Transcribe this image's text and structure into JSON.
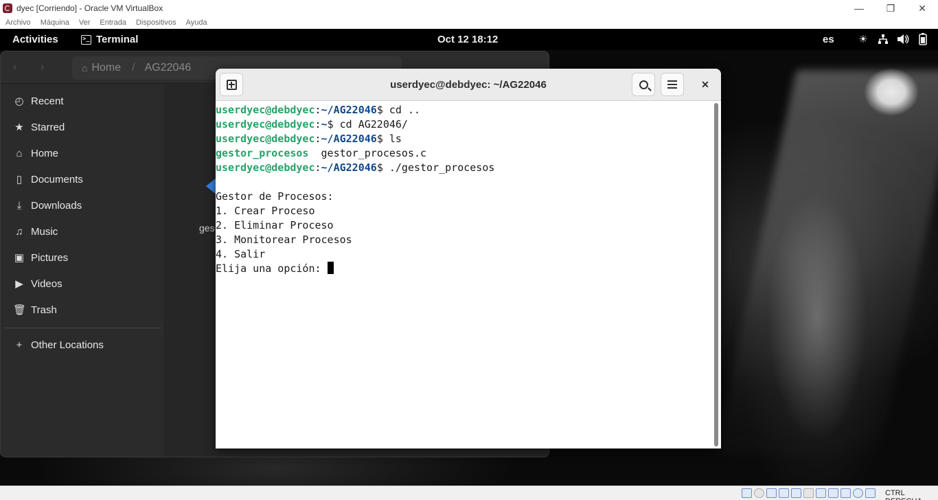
{
  "host_window": {
    "title": "dyec [Corriendo] - Oracle VM VirtualBox",
    "controls": {
      "minimize": "—",
      "restore": "❐",
      "close": "✕"
    },
    "menu": [
      "Archivo",
      "Máquina",
      "Ver",
      "Entrada",
      "Dispositivos",
      "Ayuda"
    ],
    "statusbar": {
      "host_key": "CTRL DERECHA"
    }
  },
  "topbar": {
    "activities": "Activities",
    "app_name": "Terminal",
    "clock": "Oct 12  18:12",
    "keyboard_layout": "es",
    "tray_icons": [
      "brightness-icon",
      "network-icon",
      "volume-icon",
      "battery-icon"
    ]
  },
  "files": {
    "pathbar": {
      "home": "Home",
      "current": "AG22046"
    },
    "sidebar": [
      {
        "label": "Recent",
        "icon": "clock-icon"
      },
      {
        "label": "Starred",
        "icon": "star-icon"
      },
      {
        "label": "Home",
        "icon": "home-icon"
      },
      {
        "label": "Documents",
        "icon": "document-icon"
      },
      {
        "label": "Downloads",
        "icon": "download-icon"
      },
      {
        "label": "Music",
        "icon": "music-icon"
      },
      {
        "label": "Pictures",
        "icon": "picture-icon"
      },
      {
        "label": "Videos",
        "icon": "video-icon"
      },
      {
        "label": "Trash",
        "icon": "trash-icon"
      }
    ],
    "other_locations": "Other Locations",
    "visible_item_fragment": "ges"
  },
  "terminal": {
    "title": "userdyec@debdyec: ~/AG22046",
    "prompt_user": "userdyec@debdyec",
    "lines": {
      "l1_path": "~/AG22046",
      "l1_cmd": "$ cd ..",
      "l2_path": "~",
      "l2_cmd": "$ cd AG22046/",
      "l3_path": "~/AG22046",
      "l3_cmd": "$ ls",
      "ls_exec": "gestor_procesos",
      "ls_file": "  gestor_procesos.c",
      "l5_path": "~/AG22046",
      "l5_cmd": "$ ./gestor_procesos",
      "menu_title": "Gestor de Procesos:",
      "opt1": "1. Crear Proceso",
      "opt2": "2. Eliminar Proceso",
      "opt3": "3. Monitorear Procesos",
      "opt4": "4. Salir",
      "prompt": "Elija una opción: "
    }
  },
  "colors": {
    "prompt_user": "#26a269",
    "prompt_path": "#12488b",
    "executable": "#26a269"
  }
}
